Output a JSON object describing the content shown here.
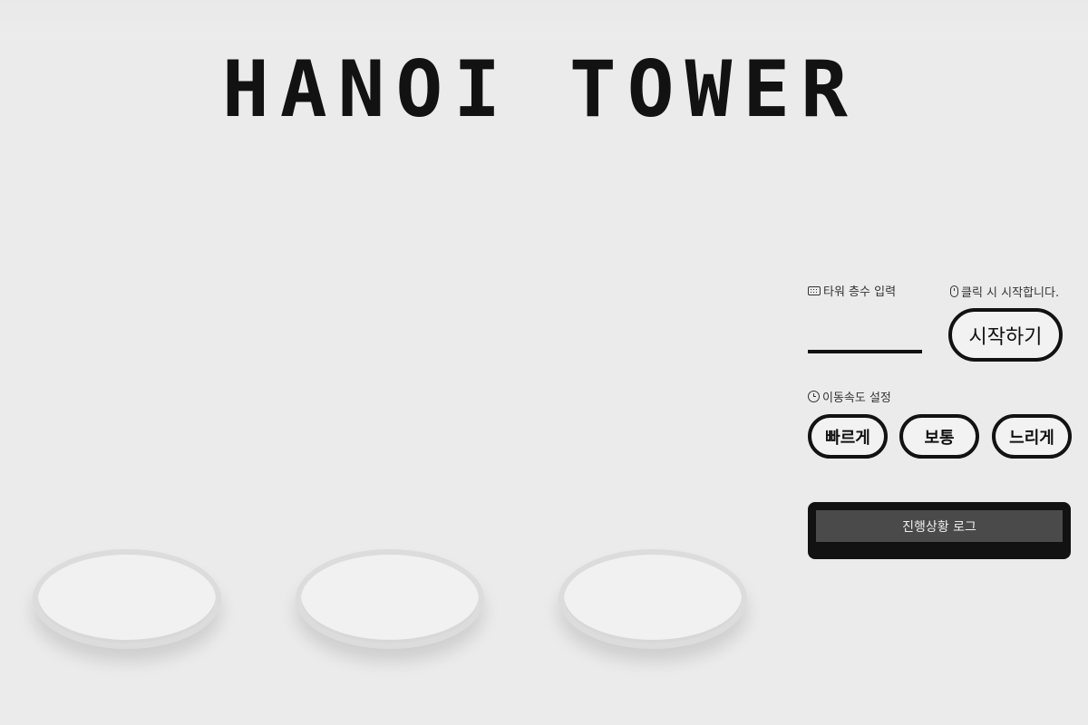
{
  "title": "HANOI TOWER",
  "towers": [
    {
      "icon": "tower-base"
    },
    {
      "icon": "tower-base"
    },
    {
      "icon": "tower-base"
    }
  ],
  "controls": {
    "floors_label": "타워 층수 입력",
    "floors_icon": "keyboard-icon",
    "floors_value": "",
    "click_hint": "클릭 시 시작합니다.",
    "click_icon": "mouse-icon",
    "start_label": "시작하기",
    "speed_label": "이동속도 설정",
    "speed_icon": "alarm-clock-icon",
    "speed_options": [
      "빠르게",
      "보통",
      "느리게"
    ]
  },
  "log": {
    "title": "진행상황 로그"
  },
  "colors": {
    "background": "#ebebeb",
    "ink": "#121212",
    "log_header": "#4a4a4a"
  }
}
